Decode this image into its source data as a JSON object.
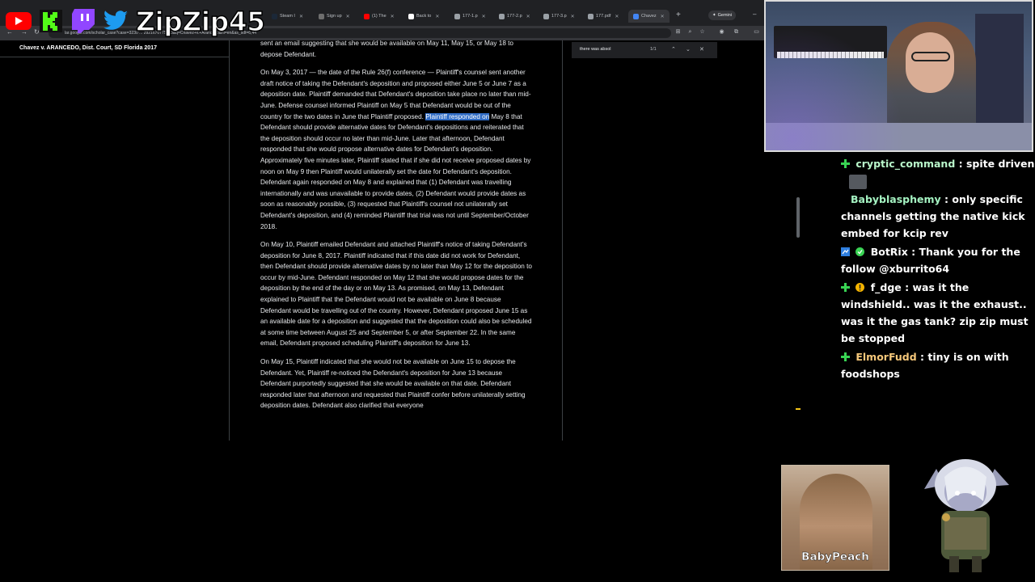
{
  "browser": {
    "tabs": [
      {
        "label": "Steam I",
        "color": "#1b2838"
      },
      {
        "label": "Sign up",
        "color": "#6e6e6e"
      },
      {
        "label": "(1) The",
        "color": "#ff0000"
      },
      {
        "label": "Back to",
        "color": "#ffffff"
      },
      {
        "label": "177-1.p",
        "color": "#9aa0a6"
      },
      {
        "label": "177-2.p",
        "color": "#9aa0a6"
      },
      {
        "label": "177-3.p",
        "color": "#9aa0a6"
      },
      {
        "label": "177.pdf",
        "color": "#9aa0a6"
      },
      {
        "label": "Chavez",
        "color": "#4285f4"
      }
    ],
    "gemini_label": "Gemini",
    "url": "lar.google.com/scholar_case?case=3230 ... 2921670775193&q=Chavez+v.+Arancedo&hl=en&as_sdt=6,44"
  },
  "page": {
    "case_title": "Chavez v. ARANCEDO, Dist. Court, SD Florida 2017",
    "paragraphs": [
      {
        "before": "sent an email suggesting that she would be available on May 11, May 15, or May 18 to depose Defendant.",
        "highlight": "",
        "after": ""
      },
      {
        "before": "On May 3, 2017 — the date of the Rule 26(f) conference — Plaintiff's counsel sent another draft notice of taking the Defendant's deposition and proposed either June 5 or June 7 as a deposition date. Plaintiff demanded that Defendant's deposition take place no later than mid-June. Defense counsel informed Plaintiff on May 5 that Defendant would be out of the country for the two dates in June that Plaintiff proposed. ",
        "highlight": "Plaintiff responded on",
        "after": " May 8 that Defendant should provide alternative dates for Defendant's depositions and reiterated that the deposition should occur no later than mid-June. Later that afternoon, Defendant responded that she would propose alternative dates for Defendant's deposition. Approximately five minutes later, Plaintiff stated that if she did not receive proposed dates by noon on May 9 then Plaintiff would unilaterally set the date for Defendant's deposition. Defendant again responded on May 8 and explained that (1) Defendant was travelling internationally and was unavailable to provide dates, (2) Defendant would provide dates as soon as reasonably possible, (3) requested that Plaintiff's counsel not unilaterally set Defendant's deposition, and (4) reminded Plaintiff that trial was not until September/October 2018."
      },
      {
        "before": "On May 10, Plaintiff emailed Defendant and attached Plaintiff's notice of taking Defendant's deposition for June 8, 2017. Plaintiff indicated that if this date did not work for Defendant, then Defendant should provide alternative dates by no later than May 12 for the deposition to occur by mid-June. Defendant responded on May 12 that she would propose dates for the deposition by the end of the day or on May 13. As promised, on May 13, Defendant explained to Plaintiff that the Defendant would not be available on June 8 because Defendant would be travelling out of the country. However, Defendant proposed June 15 as an available date for a deposition and suggested that the deposition could also be scheduled at some time between August 25 and September 5, or after September 22. In the same email, Defendant proposed scheduling Plaintiff's deposition for June 13.",
        "highlight": "",
        "after": ""
      },
      {
        "before": "On May 15, Plaintiff indicated that she would not be available on June 15 to depose the Defendant. Yet, Plaintiff re-noticed the Defendant's deposition for June 13 because Defendant purportedly suggested that she would be available on that date. Defendant responded later that afternoon and requested that Plaintiff confer before unilaterally setting deposition dates. Defendant also clarified that everyone",
        "highlight": "",
        "after": ""
      }
    ],
    "find": {
      "query": "there was absol",
      "count": "1/1"
    }
  },
  "stream": {
    "handle": "ZipZip45",
    "chat": [
      {
        "user": "cryptic_command",
        "color": "#b9f6ca",
        "badge": "#39d353",
        "text": "spite driven",
        "emote": true
      },
      {
        "user": "Babyblasphemy",
        "color": "#a5f3c2",
        "badge": "",
        "text": "only specific channels getting the native kick embed for kcip rev",
        "emote": false
      },
      {
        "user": "BotRix",
        "color": "#ffffff",
        "badge": "#2f7fe0",
        "text": "Thank you for the follow @xburrito64",
        "emote": false
      },
      {
        "user": "f_dge",
        "color": "#ffffff",
        "badge": "#39d353",
        "text": "was it the windshield.. was it the exhaust.. was it the gas tank? zip zip must be stopped",
        "emote": false
      },
      {
        "user": "ElmorFudd",
        "color": "#f5c77a",
        "badge": "#39d353",
        "text": "tiny is on with foodshops",
        "emote": false
      }
    ],
    "avatar_label": "BabyPeach"
  }
}
